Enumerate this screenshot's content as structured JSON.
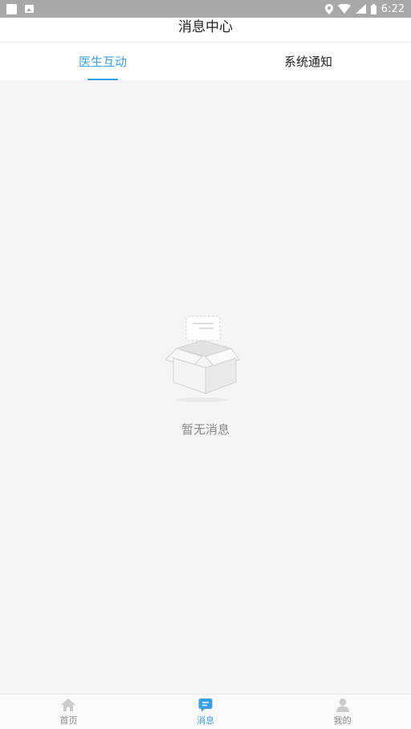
{
  "status_bar": {
    "time": "6:22"
  },
  "header": {
    "title": "消息中心"
  },
  "tabs": [
    {
      "label": "医生互动",
      "active": true
    },
    {
      "label": "系统通知",
      "active": false
    }
  ],
  "empty_state": {
    "text": "暂无消息"
  },
  "bottom_nav": {
    "items": [
      {
        "label": "首页",
        "icon": "home-icon",
        "active": false
      },
      {
        "label": "消息",
        "icon": "message-icon",
        "active": true
      },
      {
        "label": "我的",
        "icon": "user-icon",
        "active": false
      }
    ]
  },
  "colors": {
    "accent": "#3aa1e6",
    "background": "#f5f5f5"
  }
}
